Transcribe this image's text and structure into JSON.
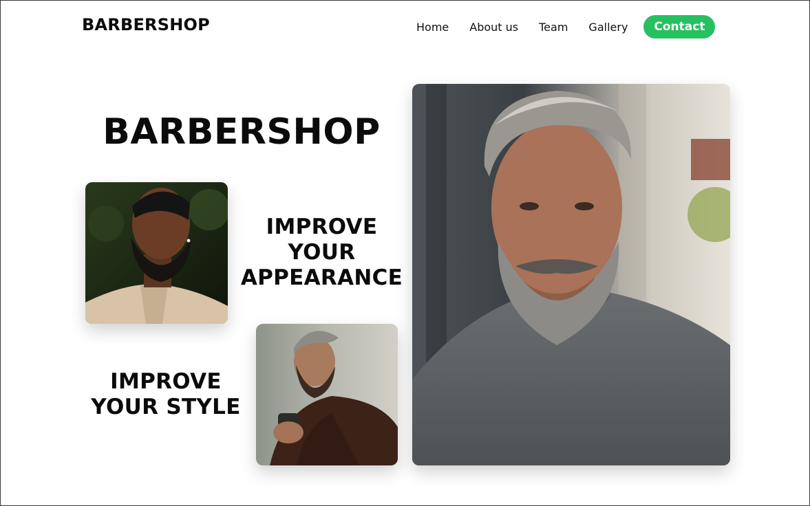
{
  "header": {
    "logo": "BARBERSHOP",
    "nav": [
      "Home",
      "About us",
      "Team",
      "Gallery"
    ],
    "contact_label": "Contact"
  },
  "hero": {
    "title": "BARBERSHOP",
    "tagline_1": [
      "IMPROVE",
      "YOUR",
      "APPEARANCE"
    ],
    "tagline_2": [
      "IMPROVE",
      "YOUR STYLE"
    ]
  },
  "colors": {
    "accent": "#27c060",
    "text": "#0b0b0b"
  }
}
